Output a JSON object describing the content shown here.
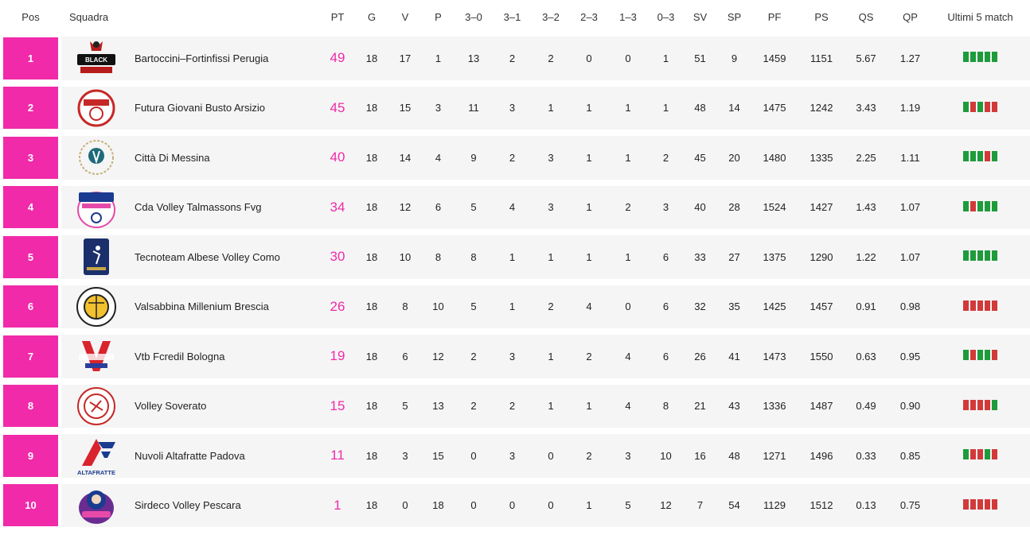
{
  "headers": [
    "Pos",
    "Squadra",
    "PT",
    "G",
    "V",
    "P",
    "3–0",
    "3–1",
    "3–2",
    "2–3",
    "1–3",
    "0–3",
    "SV",
    "SP",
    "PF",
    "PS",
    "QS",
    "QP",
    "Ultimi 5 match"
  ],
  "colors": {
    "accent": "#f02aa9",
    "win": "#1e9b3b",
    "loss": "#d23a3a"
  },
  "rows": [
    {
      "pos": "1",
      "team": "Bartoccini–Fortinfissi Perugia",
      "logo": "black-angels-logo-icon",
      "pt": "49",
      "g": "18",
      "v": "17",
      "p": "1",
      "s30": "13",
      "s31": "2",
      "s32": "2",
      "s23": "0",
      "s13": "0",
      "s03": "1",
      "sv": "51",
      "sp": "9",
      "pf": "1459",
      "ps": "1151",
      "qs": "5.67",
      "qp": "1.27",
      "form": [
        "W",
        "W",
        "W",
        "W",
        "W"
      ]
    },
    {
      "pos": "2",
      "team": "Futura Giovani Busto Arsizio",
      "logo": "futura-giovani-logo-icon",
      "pt": "45",
      "g": "18",
      "v": "15",
      "p": "3",
      "s30": "11",
      "s31": "3",
      "s32": "1",
      "s23": "1",
      "s13": "1",
      "s03": "1",
      "sv": "48",
      "sp": "14",
      "pf": "1475",
      "ps": "1242",
      "qs": "3.43",
      "qp": "1.19",
      "form": [
        "W",
        "L",
        "W",
        "L",
        "L"
      ]
    },
    {
      "pos": "3",
      "team": "Città Di Messina",
      "logo": "akademia-sant-anna-logo-icon",
      "pt": "40",
      "g": "18",
      "v": "14",
      "p": "4",
      "s30": "9",
      "s31": "2",
      "s32": "3",
      "s23": "1",
      "s13": "1",
      "s03": "2",
      "sv": "45",
      "sp": "20",
      "pf": "1480",
      "ps": "1335",
      "qs": "2.25",
      "qp": "1.11",
      "form": [
        "W",
        "W",
        "W",
        "L",
        "W"
      ]
    },
    {
      "pos": "4",
      "team": "Cda Volley Talmassons Fvg",
      "logo": "cda-volley-logo-icon",
      "pt": "34",
      "g": "18",
      "v": "12",
      "p": "6",
      "s30": "5",
      "s31": "4",
      "s32": "3",
      "s23": "1",
      "s13": "2",
      "s03": "3",
      "sv": "40",
      "sp": "28",
      "pf": "1524",
      "ps": "1427",
      "qs": "1.43",
      "qp": "1.07",
      "form": [
        "W",
        "L",
        "W",
        "W",
        "W"
      ]
    },
    {
      "pos": "5",
      "team": "Tecnoteam Albese Volley Como",
      "logo": "albese-volley-logo-icon",
      "pt": "30",
      "g": "18",
      "v": "10",
      "p": "8",
      "s30": "8",
      "s31": "1",
      "s32": "1",
      "s23": "1",
      "s13": "1",
      "s03": "6",
      "sv": "33",
      "sp": "27",
      "pf": "1375",
      "ps": "1290",
      "qs": "1.22",
      "qp": "1.07",
      "form": [
        "W",
        "W",
        "W",
        "W",
        "W"
      ]
    },
    {
      "pos": "6",
      "team": "Valsabbina Millenium Brescia",
      "logo": "millenium-brescia-logo-icon",
      "pt": "26",
      "g": "18",
      "v": "8",
      "p": "10",
      "s30": "5",
      "s31": "1",
      "s32": "2",
      "s23": "4",
      "s13": "0",
      "s03": "6",
      "sv": "32",
      "sp": "35",
      "pf": "1425",
      "ps": "1457",
      "qs": "0.91",
      "qp": "0.98",
      "form": [
        "L",
        "L",
        "L",
        "L",
        "L"
      ]
    },
    {
      "pos": "7",
      "team": "Vtb Fcredil Bologna",
      "logo": "volley-team-bologna-logo-icon",
      "pt": "19",
      "g": "18",
      "v": "6",
      "p": "12",
      "s30": "2",
      "s31": "3",
      "s32": "1",
      "s23": "2",
      "s13": "4",
      "s03": "6",
      "sv": "26",
      "sp": "41",
      "pf": "1473",
      "ps": "1550",
      "qs": "0.63",
      "qp": "0.95",
      "form": [
        "W",
        "L",
        "W",
        "W",
        "L"
      ]
    },
    {
      "pos": "8",
      "team": "Volley Soverato",
      "logo": "volley-soverato-logo-icon",
      "pt": "15",
      "g": "18",
      "v": "5",
      "p": "13",
      "s30": "2",
      "s31": "2",
      "s32": "1",
      "s23": "1",
      "s13": "4",
      "s03": "8",
      "sv": "21",
      "sp": "43",
      "pf": "1336",
      "ps": "1487",
      "qs": "0.49",
      "qp": "0.90",
      "form": [
        "L",
        "L",
        "L",
        "L",
        "W"
      ]
    },
    {
      "pos": "9",
      "team": "Nuvoli Altafratte Padova",
      "logo": "altafratte-logo-icon",
      "logo_text": "ALTAFRATTE",
      "pt": "11",
      "g": "18",
      "v": "3",
      "p": "15",
      "s30": "0",
      "s31": "3",
      "s32": "0",
      "s23": "2",
      "s13": "3",
      "s03": "10",
      "sv": "16",
      "sp": "48",
      "pf": "1271",
      "ps": "1496",
      "qs": "0.33",
      "qp": "0.85",
      "form": [
        "W",
        "L",
        "L",
        "W",
        "L"
      ]
    },
    {
      "pos": "10",
      "team": "Sirdeco Volley Pescara",
      "logo": "sirdeco-pescara-logo-icon",
      "pt": "1",
      "g": "18",
      "v": "0",
      "p": "18",
      "s30": "0",
      "s31": "0",
      "s32": "0",
      "s23": "1",
      "s13": "5",
      "s03": "12",
      "sv": "7",
      "sp": "54",
      "pf": "1129",
      "ps": "1512",
      "qs": "0.13",
      "qp": "0.75",
      "form": [
        "L",
        "L",
        "L",
        "L",
        "L"
      ]
    }
  ]
}
